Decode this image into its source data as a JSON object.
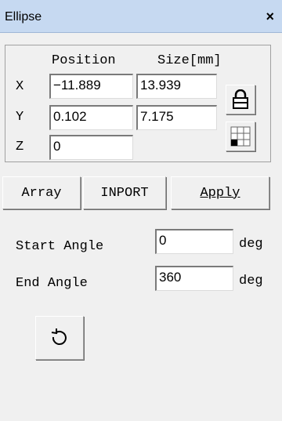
{
  "window": {
    "title": "Ellipse",
    "close_label": "×"
  },
  "position_size": {
    "position_header": "Position",
    "size_header": "Size[mm]",
    "rows": [
      {
        "axis": "X",
        "position": "−11.889",
        "size": "13.939"
      },
      {
        "axis": "Y",
        "position": "0.102",
        "size": "7.175"
      },
      {
        "axis": "Z",
        "position": "0"
      }
    ],
    "icons": [
      "lock-icon",
      "grid-anchor-icon"
    ]
  },
  "buttons": {
    "array": "Array",
    "import": "INPORT",
    "apply": "Apply"
  },
  "angles": {
    "start_label": "Start Angle",
    "start_value": "0",
    "end_label": "End Angle",
    "end_value": "360",
    "unit": "deg"
  },
  "rotate_icon": "rotate-ccw-icon"
}
